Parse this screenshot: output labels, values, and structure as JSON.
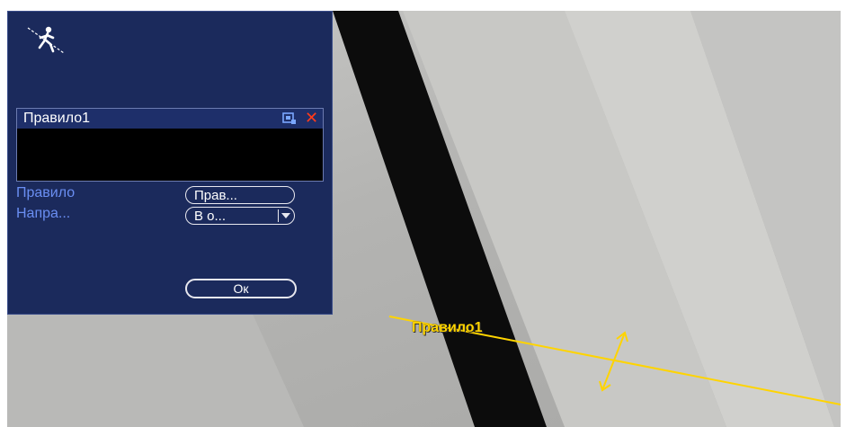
{
  "panel": {
    "icon": "tripwire-person-icon",
    "rules": [
      {
        "name": "Правило1",
        "edit_icon": "edit-rule-icon",
        "delete_icon": "delete-rule-icon"
      }
    ],
    "fields": {
      "rule_label": "Правило",
      "rule_button": "Прав...",
      "direction_label": "Напра...",
      "direction_value": "В о..."
    },
    "ok_label": "Ок"
  },
  "overlay": {
    "rule_label": "Правило1"
  },
  "colors": {
    "panel_bg": "#1b2a5c",
    "label_blue": "#6a8ef2",
    "tripwire_yellow": "#ffd400",
    "delete_red": "#ff3b1a"
  }
}
